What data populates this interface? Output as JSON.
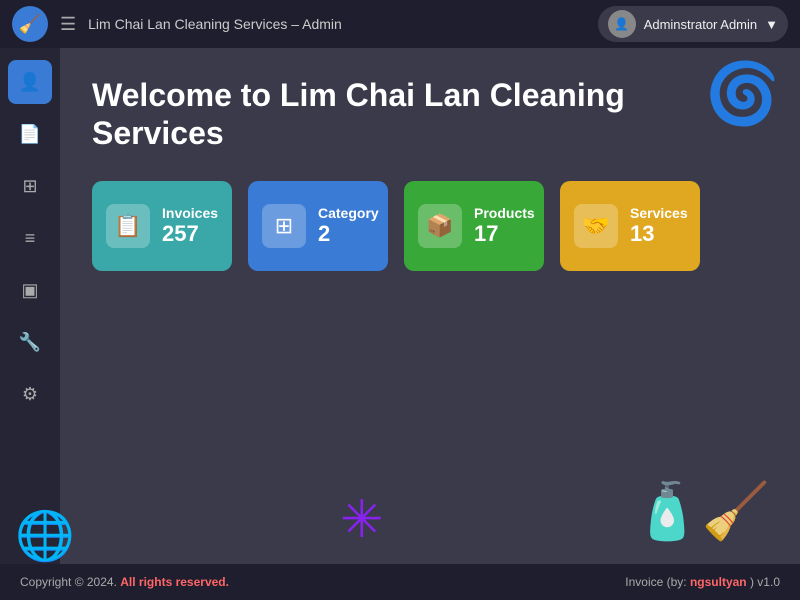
{
  "navbar": {
    "title": "Lim Chai Lan Cleaning Services – Admin",
    "hamburger": "☰",
    "user": {
      "label": "Adminstrator Admin",
      "dropdown": "▼"
    }
  },
  "sidebar": {
    "items": [
      {
        "id": "dashboard",
        "icon": "👤",
        "active": true
      },
      {
        "id": "documents",
        "icon": "📄",
        "active": false
      },
      {
        "id": "grid",
        "icon": "▦",
        "active": false
      },
      {
        "id": "list",
        "icon": "☰",
        "active": false
      },
      {
        "id": "box",
        "icon": "📦",
        "active": false
      },
      {
        "id": "tools",
        "icon": "🔧",
        "active": false
      },
      {
        "id": "share",
        "icon": "⚙",
        "active": false
      }
    ]
  },
  "main": {
    "title": "Welcome to Lim Chai Lan Cleaning Services",
    "cards": [
      {
        "id": "invoices",
        "label": "Invoices",
        "count": "257",
        "color": "card-teal",
        "icon": "📋"
      },
      {
        "id": "category",
        "label": "Category",
        "count": "2",
        "color": "card-blue",
        "icon": "▦"
      },
      {
        "id": "products",
        "label": "Products",
        "count": "17",
        "color": "card-green",
        "icon": "📦"
      },
      {
        "id": "services",
        "label": "Services",
        "count": "13",
        "color": "card-yellow",
        "icon": "🤝"
      }
    ]
  },
  "footer": {
    "left_static": "Copyright © 2024.",
    "left_highlight": " All rights reserved.",
    "right_static": "Invoice (by: ",
    "right_highlight": "ngsultyan",
    "right_version": " ) v1.0"
  }
}
